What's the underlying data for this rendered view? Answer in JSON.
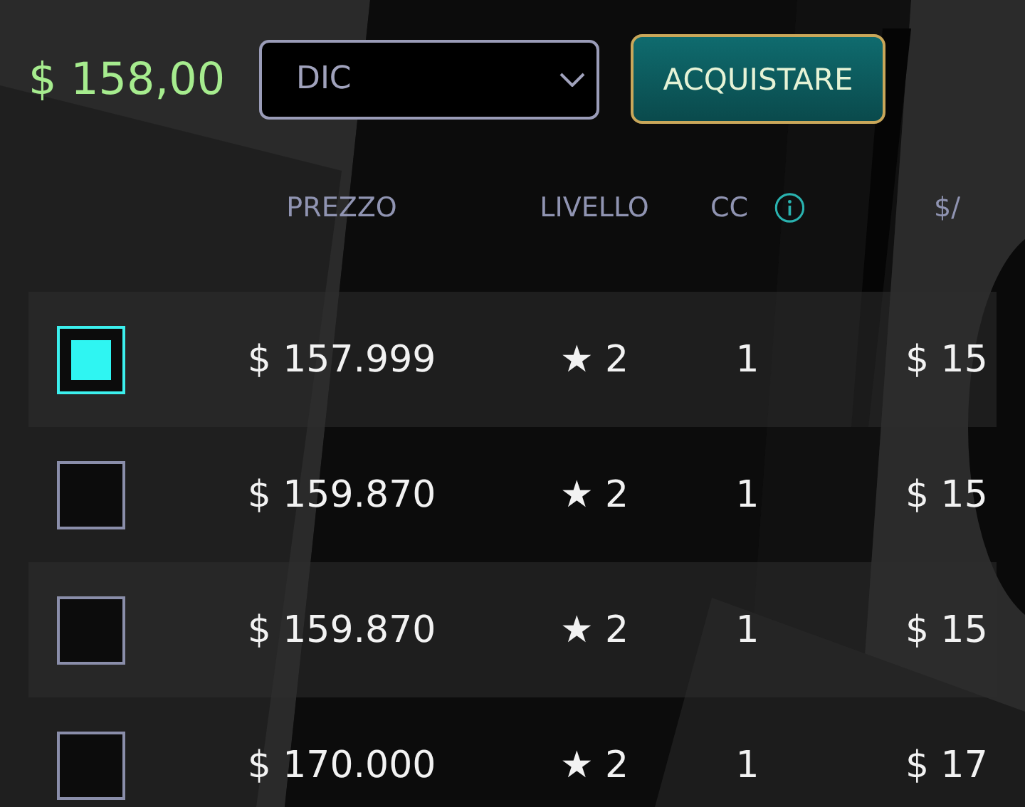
{
  "balance": "$ 158,00",
  "month_select": {
    "value": "DIC"
  },
  "buy_button": "ACQUISTARE",
  "table": {
    "columns": [
      "PREZZO",
      "LIVELLO",
      "CC",
      "$/"
    ],
    "rows": [
      {
        "selected": true,
        "price": "$ 157.999",
        "level": "★ 2",
        "cc": "1",
        "column_4": "$ 15"
      },
      {
        "selected": false,
        "price": "$ 159.870",
        "level": "★ 2",
        "cc": "1",
        "column_4": "$ 15"
      },
      {
        "selected": false,
        "price": "$ 159.870",
        "level": "★ 2",
        "cc": "1",
        "column_4": "$ 15"
      },
      {
        "selected": false,
        "price": "$ 170.000",
        "level": "★ 2",
        "cc": "1",
        "column_4": "$ 17"
      }
    ]
  }
}
